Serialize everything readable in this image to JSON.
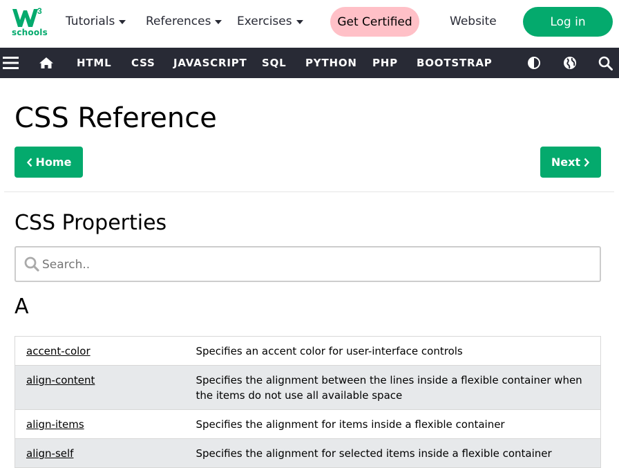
{
  "topbar": {
    "logo_text": "schools",
    "logo_superscript": "3",
    "nav": [
      {
        "label": "Tutorials"
      },
      {
        "label": "References"
      },
      {
        "label": "Exercises"
      }
    ],
    "get_certified": "Get Certified",
    "website": "Website",
    "login": "Log in"
  },
  "darknav": {
    "items": [
      "HTML",
      "CSS",
      "JAVASCRIPT",
      "SQL",
      "PYTHON",
      "PHP",
      "BOOTSTRAP"
    ],
    "icons": [
      "menu-icon",
      "home-icon",
      "contrast-icon",
      "globe-icon",
      "search-icon"
    ]
  },
  "main": {
    "title": "CSS Reference",
    "home_button": "Home",
    "next_button": "Next",
    "section_title": "CSS Properties",
    "search_placeholder": "Search..",
    "letter": "A",
    "properties": [
      {
        "name": "accent-color",
        "description": "Specifies an accent color for user-interface controls"
      },
      {
        "name": "align-content",
        "description": "Specifies the alignment between the lines inside a flexible container when the items do not use all available space"
      },
      {
        "name": "align-items",
        "description": "Specifies the alignment for items inside a flexible container"
      },
      {
        "name": "align-self",
        "description": "Specifies the alignment for selected items inside a flexible container"
      }
    ]
  },
  "colors": {
    "brand_green": "#04AA6D",
    "nav_dark": "#282A35",
    "cert_pink": "#FFC0C7",
    "row_alt": "#E7E9EB"
  }
}
